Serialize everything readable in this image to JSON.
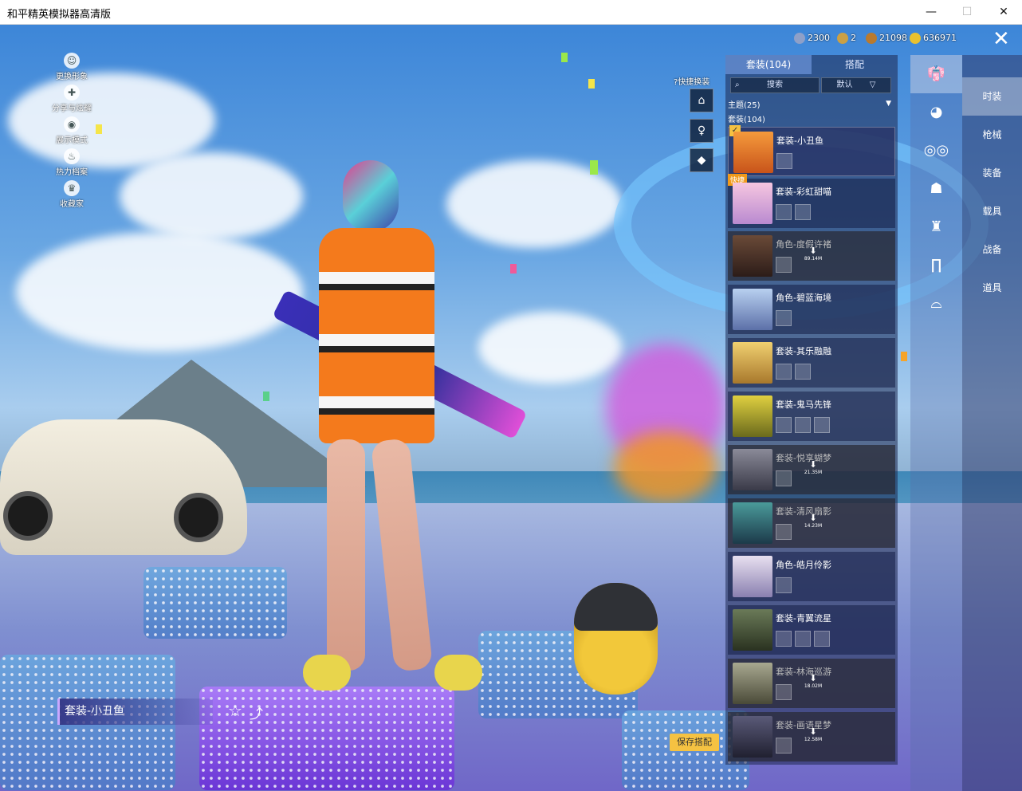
{
  "window": {
    "title": "和平精英模拟器高清版",
    "minimize": "—",
    "maximize": "☐",
    "close": "✕"
  },
  "side_menu": [
    {
      "label": "更换形象",
      "icon": "avatar-icon"
    },
    {
      "label": "分享与炫耀",
      "icon": "share-icon"
    },
    {
      "label": "展示模式",
      "icon": "eye-icon"
    },
    {
      "label": "热力档案",
      "icon": "flame-icon"
    },
    {
      "label": "收藏家",
      "icon": "trophy-icon"
    }
  ],
  "currencies": [
    {
      "value": "2300",
      "color": "#8fa0c8",
      "icon": "coin-icon"
    },
    {
      "value": "2",
      "color": "#caa045",
      "icon": "medal-icon"
    },
    {
      "value": "21098",
      "color": "#b97a2e",
      "icon": "bonus-icon"
    },
    {
      "value": "636971",
      "color": "#e9c12f",
      "icon": "gold-icon"
    }
  ],
  "quick_change": {
    "label": "快捷换装",
    "help": "?"
  },
  "list_panel": {
    "tabs": [
      "套装(104)",
      "搭配"
    ],
    "search_placeholder": "搜索",
    "sort": "默认",
    "sort_arrow": "▽",
    "theme_label": "主题(25)",
    "suit_label": "套装(104)",
    "items": [
      {
        "name": "套装-小丑鱼",
        "selected": true,
        "download": ""
      },
      {
        "name": "套装-彩虹甜喵",
        "quick": "快捷",
        "download": ""
      },
      {
        "name": "角色-度假许褚",
        "download": "89.14M"
      },
      {
        "name": "角色-碧蓝海境",
        "download": ""
      },
      {
        "name": "套装-其乐融融",
        "download": ""
      },
      {
        "name": "套装-鬼马先锋",
        "download": ""
      },
      {
        "name": "套装-悦享蝴梦",
        "download": "21.35M"
      },
      {
        "name": "套装-清风扇影",
        "download": "14.23M"
      },
      {
        "name": "角色-皓月伶影",
        "download": ""
      },
      {
        "name": "套装-青翼流星",
        "download": ""
      },
      {
        "name": "套装-林海巡游",
        "download": "18.02M"
      },
      {
        "name": "套装-画语星梦",
        "download": "12.58M"
      }
    ]
  },
  "categories": [
    "时装",
    "枪械",
    "装备",
    "载具",
    "战备",
    "道具"
  ],
  "name_tag": "套装-小丑鱼",
  "save_button": "保存搭配",
  "close_label": "✕"
}
